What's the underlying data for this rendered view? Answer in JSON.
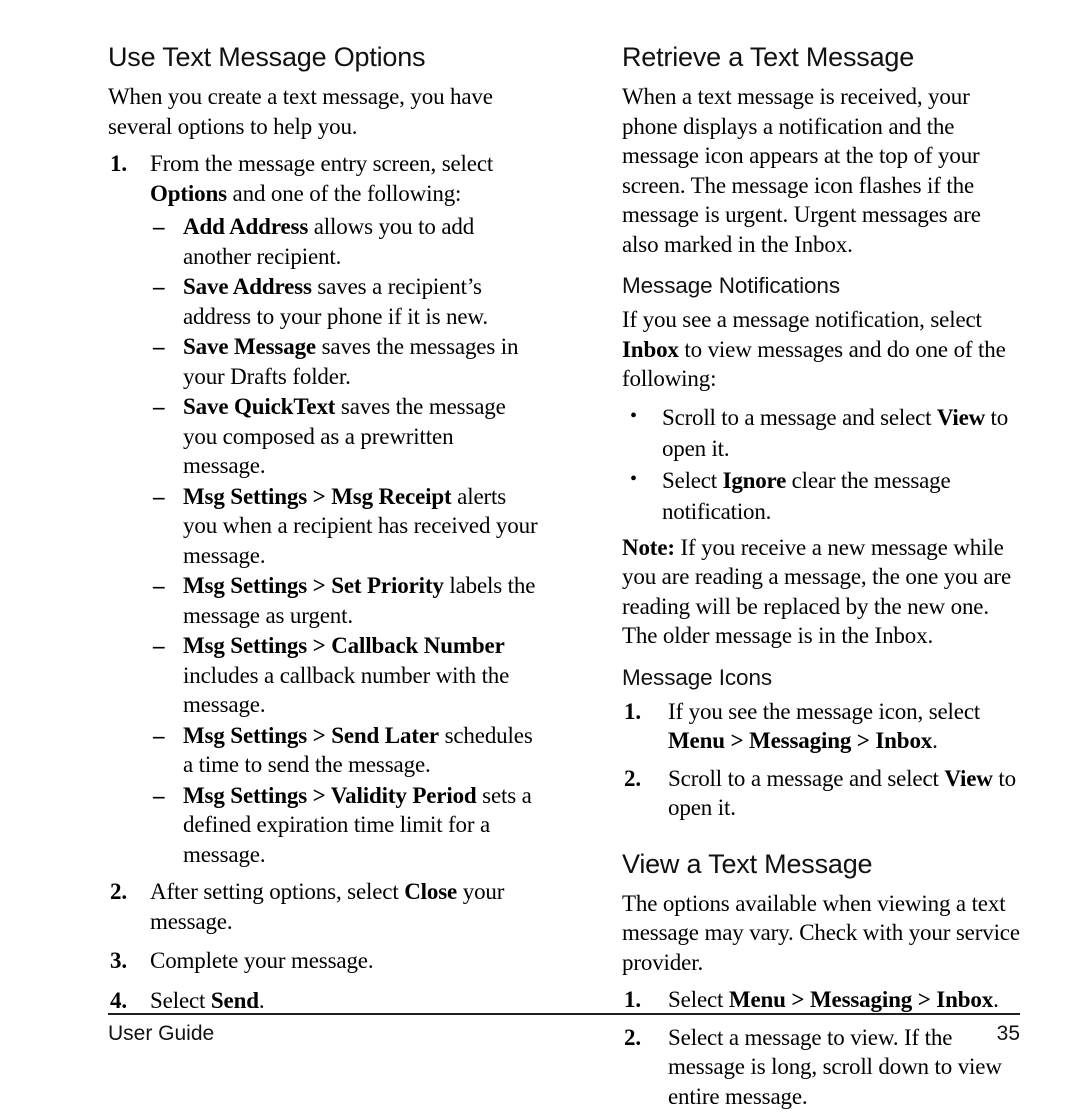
{
  "footer": {
    "left_label": "User Guide",
    "page_number": "35"
  },
  "left_column": {
    "section_title": "Use Text Message Options",
    "intro": "When you create a text message, you have several options to help you.",
    "step1": {
      "marker": "1.",
      "text_before_bold": "From the message entry screen, select ",
      "bold": "Options",
      "text_after_bold": " and one of the following:"
    },
    "options": [
      {
        "marker": "–",
        "bold": "Add Address",
        "rest": " allows you to add another recipient."
      },
      {
        "marker": "–",
        "bold": "Save Address",
        "rest": " saves a recipient’s address to your phone if it is new."
      },
      {
        "marker": "–",
        "bold": "Save Message",
        "rest": " saves the messages in your Drafts folder."
      },
      {
        "marker": "–",
        "bold": "Save QuickText",
        "rest": " saves the message you composed as a prewritten message."
      },
      {
        "marker": "–",
        "bold": "Msg Settings > Msg Receipt",
        "rest": " alerts you when a recipient has received your message."
      },
      {
        "marker": "–",
        "bold": "Msg Settings > Set Priority",
        "rest": " labels the message as urgent."
      },
      {
        "marker": "–",
        "bold": "Msg Settings > Callback Number",
        "rest": " includes a callback number with the message."
      },
      {
        "marker": "–",
        "bold": "Msg Settings > Send Later",
        "rest": " schedules a time to send the message."
      },
      {
        "marker": "–",
        "bold": "Msg Settings > Validity Period",
        "rest": " sets a defined expiration time limit for a message."
      }
    ],
    "step2": {
      "marker": "2.",
      "text_before_bold": "After setting options, select ",
      "bold": "Close",
      "text_after_bold": " your message."
    },
    "step3": {
      "marker": "3.",
      "text": "Complete your message."
    },
    "step4": {
      "marker": "4.",
      "text_before_bold": "Select ",
      "bold": "Send",
      "text_after_bold": "."
    }
  },
  "right_column": {
    "section_title": "Retrieve a Text Message",
    "intro": "When a text message is received, your phone displays a notification and the message icon appears at the top of your screen. The message icon flashes if the message is urgent. Urgent messages are also marked in the Inbox.",
    "notifications": {
      "subtitle": "Message Notifications",
      "lead_before_bold": "If you see a message notification, select ",
      "lead_bold": "Inbox",
      "lead_after_bold": " to view messages and do one of the following:",
      "bullets": [
        {
          "marker": "•",
          "before_bold": "Scroll to a message and select ",
          "bold": "View",
          "after_bold": " to open it."
        },
        {
          "marker": "•",
          "before_bold": "Select ",
          "bold": "Ignore",
          "after_bold": " clear the message notification."
        }
      ]
    },
    "note": {
      "label": "Note:",
      "text": " If you receive a new message while you are reading a message, the one you are reading will be replaced by the new one. The older message is in the Inbox."
    },
    "icons": {
      "subtitle": "Message Icons",
      "steps": [
        {
          "marker": "1.",
          "before_bold": "If you see the message icon, select ",
          "bold": "Menu > Messaging > Inbox",
          "after_bold": "."
        },
        {
          "marker": "2.",
          "before_bold": "Scroll to a message and select ",
          "bold": "View",
          "after_bold": " to open it."
        }
      ]
    },
    "view_message": {
      "section_title": "View a Text Message",
      "intro": "The options available when viewing a text message may vary. Check with your service provider.",
      "steps": [
        {
          "marker": "1.",
          "before_bold": "Select ",
          "bold": "Menu  >  Messaging  >  Inbox",
          "after_bold": "."
        },
        {
          "marker": "2.",
          "before_bold": "Select a message to view. If the message is long, scroll down to view entire message.",
          "bold": "",
          "after_bold": ""
        }
      ]
    }
  }
}
